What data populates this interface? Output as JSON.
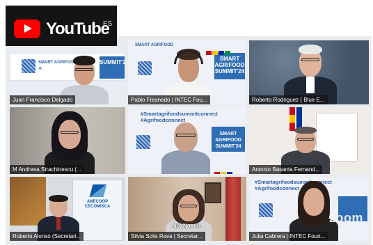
{
  "overlay": {
    "brand": "YouTube",
    "language": "ES"
  },
  "tiles": [
    {
      "name": "Juan Francisco Delgado"
    },
    {
      "name": "Pablo Fresnedo | INTEC Fou..."
    },
    {
      "name": "Roberto Rodriguez ( Blue E..."
    },
    {
      "name": "M Andreea  Strachinescu (..."
    },
    {
      "name": ""
    },
    {
      "name": "Antonio Basanta Fernand..."
    },
    {
      "name": "Roberto Alonso (Secretari..."
    },
    {
      "name": "Silvia Solis Rava | Secretar..."
    },
    {
      "name": "Julia Cabrera | INTEC Foun..."
    }
  ],
  "banner": {
    "summit_line1": "SMART AGRIFOOD",
    "summit_line2": "SUMMIT'24",
    "hashtag1": "#Smartagrifoodsummitconnect",
    "hashtag2": "#Agrifoodconnect"
  },
  "company_sign": {
    "line1": "ANECOOP",
    "line2": "CECOMISCA"
  },
  "caption": "No, No, no.",
  "zoom_watermark": "zoom",
  "colors": {
    "active_border": "#52c41a",
    "youtube_red": "#ff0000",
    "banner_blue": "#2f6db5"
  }
}
